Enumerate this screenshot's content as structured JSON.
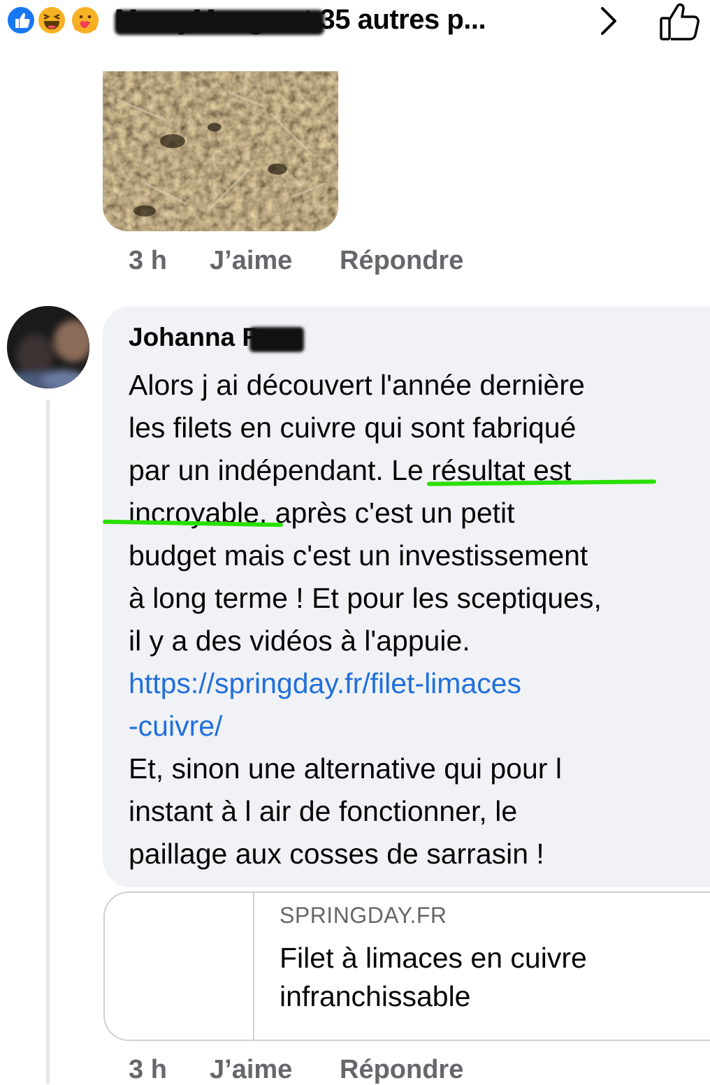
{
  "reactions": {
    "summary_text": "MamyMango et 35 autres p...",
    "types": [
      "like-icon",
      "haha-icon",
      "care-icon"
    ],
    "chevron_icon": "chevron-right-icon",
    "like_icon": "thumbs-up-outline-icon"
  },
  "photo_comment": {
    "time": "3 h",
    "like_label": "J’aime",
    "reply_label": "Répondre"
  },
  "comment": {
    "author": "Johanna R",
    "text_before_link": "Alors j ai découvert l'année dernière\nles filets en cuivre qui sont fabriqué\npar un indépendant. Le résultat est\nincroyable, après c'est un petit\nbudget mais c'est un investissement\nà long terme ! Et pour les sceptiques,\nil y a des vidéos à l'appuie.",
    "link": "https://springday.fr/filet-limaces\n-cuivre/",
    "text_after_link": "Et, sinon une alternative qui pour l\ninstant à l air de fonctionner, le\npaillage aux cosses de sarrasin !",
    "highlighted_phrase": "Le résultat est incroyable",
    "highlight_color": "#28e000",
    "link_color": "#216fdb"
  },
  "link_preview": {
    "domain": "SPRINGDAY.FR",
    "title": "Filet à limaces en cuivre infranchissable"
  },
  "comment_meta": {
    "time": "3 h",
    "like_label": "J’aime",
    "reply_label": "Répondre"
  },
  "colors": {
    "bubble": "#f0f2f5",
    "meta_text": "#65676b",
    "facebook_blue": "#1877f2"
  }
}
